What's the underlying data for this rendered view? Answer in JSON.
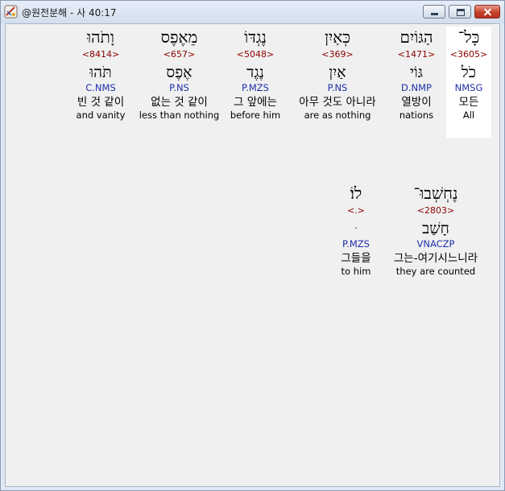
{
  "window": {
    "title": "@원전분해 - 사 40:17"
  },
  "words": [
    {
      "hebrew": "כָּל־",
      "strong": "<3605>",
      "lemma": "כֹל",
      "parse": "NMSG",
      "korean": "모든",
      "english": "All"
    },
    {
      "hebrew": "הַגּוֹיִם",
      "strong": "<1471>",
      "lemma": "גּוֹי",
      "parse": "D.NMP",
      "korean": "열방이",
      "english": "nations"
    },
    {
      "hebrew": "כְּאַיִן",
      "strong": "<369>",
      "lemma": "אַיִן",
      "parse": "P.NS",
      "korean": "아무 것도 아니라",
      "english": "are as nothing"
    },
    {
      "hebrew": "נֶגְדּוֹ",
      "strong": "<5048>",
      "lemma": "נֶגֶד",
      "parse": "P.MZS",
      "korean": "그 앞에는",
      "english": "before him"
    },
    {
      "hebrew": "מֵאֶפֶס",
      "strong": "<657>",
      "lemma": "אֶפֶס",
      "parse": "P.NS",
      "korean": "없는 것 같이",
      "english": "less than nothing"
    },
    {
      "hebrew": "וָתֹהוּ",
      "strong": "<8414>",
      "lemma": "תֹּהוּ",
      "parse": "C.NMS",
      "korean": "빈 것 같이",
      "english": "and vanity"
    },
    {
      "hebrew": "נֶחְשְׁבוּ־",
      "strong": "<2803>",
      "lemma": "חָשַׁב",
      "parse": "VNACZP",
      "korean": "그는-여기시느니라",
      "english": "they are counted"
    },
    {
      "hebrew": "לוֹ׃",
      "strong": "<.>",
      "lemma": "ּ",
      "parse": "P.MZS",
      "korean": "그들을",
      "english": "to him"
    }
  ]
}
